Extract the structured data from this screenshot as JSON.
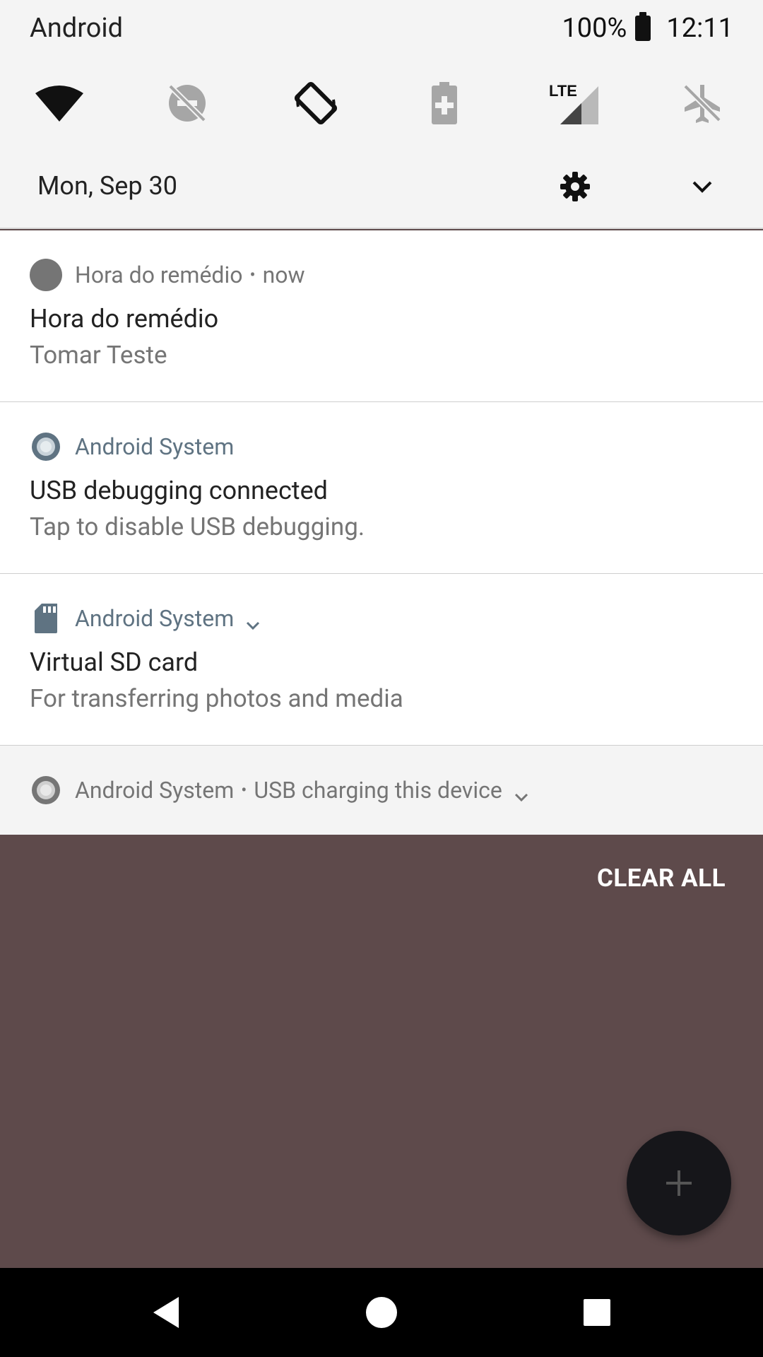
{
  "status_bar": {
    "carrier": "Android",
    "battery_percent": "100%",
    "time": "12:11"
  },
  "quick_settings": {
    "icons": [
      "wifi-icon",
      "dnd-off-icon",
      "auto-rotate-icon",
      "battery-saver-icon",
      "lte-signal-icon",
      "airplane-mode-off-icon"
    ],
    "lte_label": "LTE",
    "date": "Mon, Sep 30"
  },
  "notifications": [
    {
      "app": "Hora do remédio",
      "separator": "•",
      "meta": "now",
      "title": "Hora do remédio",
      "text": "Tomar Teste"
    },
    {
      "app": "Android System",
      "title": "USB debugging connected",
      "text": "Tap to disable USB debugging."
    },
    {
      "app": "Android System",
      "title": "Virtual SD card",
      "text": "For transferring photos and media"
    },
    {
      "app": "Android System",
      "separator": "•",
      "meta": "USB charging this device"
    }
  ],
  "actions": {
    "clear_all": "CLEAR ALL"
  },
  "colors": {
    "shade_bg": "#f4f4f4",
    "scrim_bg": "#5e4a4b",
    "app_accent": "#5f7382",
    "fab_bg": "#16161a"
  }
}
